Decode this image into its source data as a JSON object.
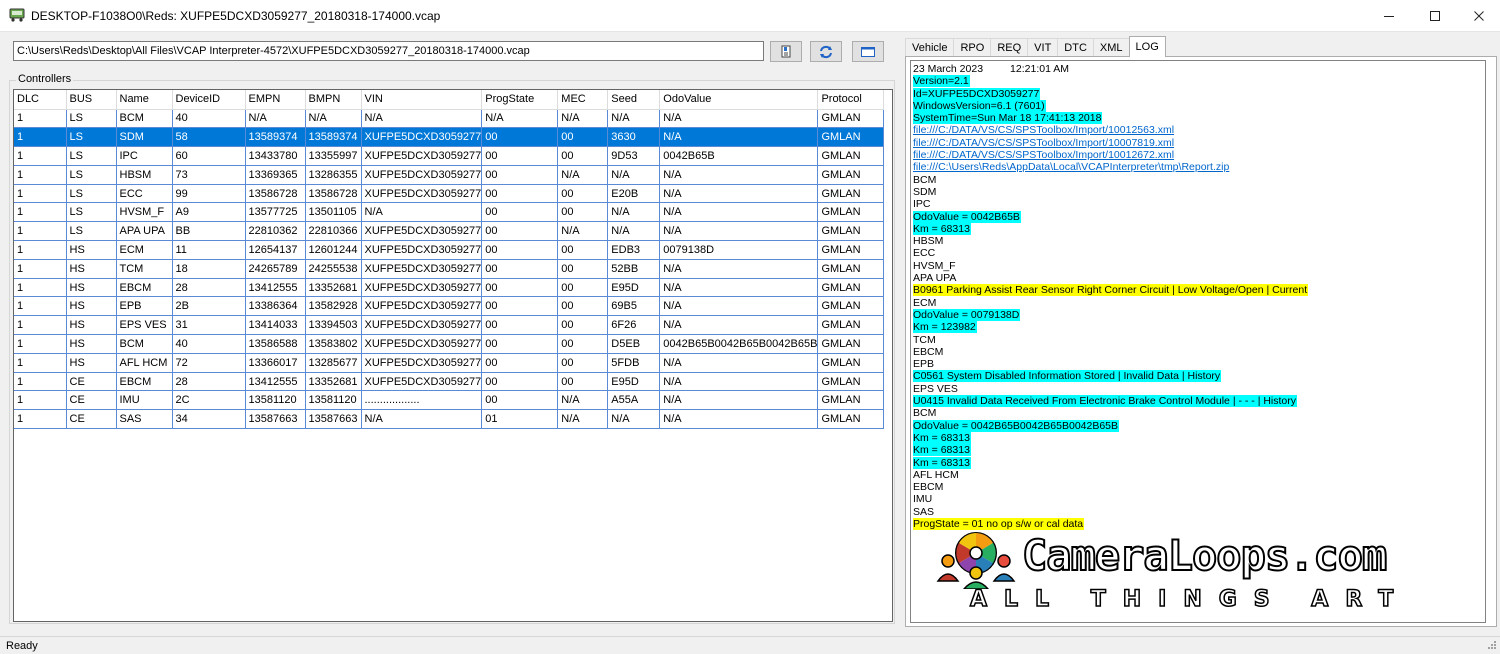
{
  "window": {
    "title": "DESKTOP-F1038O0\\Reds: XUFPE5DCXD3059277_20180318-174000.vcap"
  },
  "toolbar": {
    "path_value": "C:\\Users\\Reds\\Desktop\\All Files\\VCAP Interpreter-4572\\XUFPE5DCXD3059277_20180318-174000.vcap"
  },
  "controllers": {
    "group_label": "Controllers",
    "columns": [
      "DLC",
      "BUS",
      "Name",
      "DeviceID",
      "EMPN",
      "BMPN",
      "VIN",
      "ProgState",
      "MEC",
      "Seed",
      "OdoValue",
      "Protocol"
    ],
    "rows": [
      [
        "1",
        "LS",
        "BCM",
        "40",
        "N/A",
        "N/A",
        "N/A",
        "N/A",
        "N/A",
        "N/A",
        "N/A",
        "GMLAN"
      ],
      [
        "1",
        "LS",
        "SDM",
        "58",
        "13589374",
        "13589374",
        "XUFPE5DCXD3059277",
        "00",
        "00",
        "3630",
        "N/A",
        "GMLAN"
      ],
      [
        "1",
        "LS",
        "IPC",
        "60",
        "13433780",
        "13355997",
        "XUFPE5DCXD3059277",
        "00",
        "00",
        "9D53",
        "0042B65B",
        "GMLAN"
      ],
      [
        "1",
        "LS",
        "HBSM",
        "73",
        "13369365",
        "13286355",
        "XUFPE5DCXD3059277",
        "00",
        "N/A",
        "N/A",
        "N/A",
        "GMLAN"
      ],
      [
        "1",
        "LS",
        "ECC",
        "99",
        "13586728",
        "13586728",
        "XUFPE5DCXD3059277",
        "00",
        "00",
        "E20B",
        "N/A",
        "GMLAN"
      ],
      [
        "1",
        "LS",
        "HVSM_F",
        "A9",
        "13577725",
        "13501105",
        "N/A",
        "00",
        "00",
        "N/A",
        "N/A",
        "GMLAN"
      ],
      [
        "1",
        "LS",
        "APA UPA",
        "BB",
        "22810362",
        "22810366",
        "XUFPE5DCXD3059277",
        "00",
        "N/A",
        "N/A",
        "N/A",
        "GMLAN"
      ],
      [
        "1",
        "HS",
        "ECM",
        "11",
        "12654137",
        "12601244",
        "XUFPE5DCXD3059277",
        "00",
        "00",
        "EDB3",
        "0079138D",
        "GMLAN"
      ],
      [
        "1",
        "HS",
        "TCM",
        "18",
        "24265789",
        "24255538",
        "XUFPE5DCXD3059277",
        "00",
        "00",
        "52BB",
        "N/A",
        "GMLAN"
      ],
      [
        "1",
        "HS",
        "EBCM",
        "28",
        "13412555",
        "13352681",
        "XUFPE5DCXD3059277",
        "00",
        "00",
        "E95D",
        "N/A",
        "GMLAN"
      ],
      [
        "1",
        "HS",
        "EPB",
        "2B",
        "13386364",
        "13582928",
        "XUFPE5DCXD3059277",
        "00",
        "00",
        "69B5",
        "N/A",
        "GMLAN"
      ],
      [
        "1",
        "HS",
        "EPS VES",
        "31",
        "13414033",
        "13394503",
        "XUFPE5DCXD3059277",
        "00",
        "00",
        "6F26",
        "N/A",
        "GMLAN"
      ],
      [
        "1",
        "HS",
        "BCM",
        "40",
        "13586588",
        "13583802",
        "XUFPE5DCXD3059277",
        "00",
        "00",
        "D5EB",
        "0042B65B0042B65B0042B65B",
        "GMLAN"
      ],
      [
        "1",
        "HS",
        "AFL HCM",
        "72",
        "13366017",
        "13285677",
        "XUFPE5DCXD3059277",
        "00",
        "00",
        "5FDB",
        "N/A",
        "GMLAN"
      ],
      [
        "1",
        "CE",
        "EBCM",
        "28",
        "13412555",
        "13352681",
        "XUFPE5DCXD3059277",
        "00",
        "00",
        "E95D",
        "N/A",
        "GMLAN"
      ],
      [
        "1",
        "CE",
        "IMU",
        "2C",
        "13581120",
        "13581120",
        "..................",
        "00",
        "N/A",
        "A55A",
        "N/A",
        "GMLAN"
      ],
      [
        "1",
        "CE",
        "SAS",
        "34",
        "13587663",
        "13587663",
        "N/A",
        "01",
        "N/A",
        "N/A",
        "N/A",
        "GMLAN"
      ]
    ],
    "selected_row": 1
  },
  "tabs": [
    {
      "label": "Vehicle",
      "active": false
    },
    {
      "label": "RPO",
      "active": false
    },
    {
      "label": "REQ",
      "active": false
    },
    {
      "label": "VIT",
      "active": false
    },
    {
      "label": "DTC",
      "active": false
    },
    {
      "label": "XML",
      "active": false
    },
    {
      "label": "LOG",
      "active": true
    }
  ],
  "log": {
    "date": "23 March 2023",
    "time": "12:21:01 AM",
    "lines": [
      {
        "text": "Version=2.1",
        "style": "cyan"
      },
      {
        "text": "Id=XUFPE5DCXD3059277",
        "style": "cyan"
      },
      {
        "text": "WindowsVersion=6.1 (7601)",
        "style": "cyan"
      },
      {
        "text": "SystemTime=Sun Mar 18 17:41:13 2018",
        "style": "cyan"
      },
      {
        "text": "file:///C:/DATA/VS/CS/SPSToolbox/Import/10012563.xml",
        "style": "link"
      },
      {
        "text": "file:///C:/DATA/VS/CS/SPSToolbox/Import/10007819.xml",
        "style": "link"
      },
      {
        "text": "file:///C:/DATA/VS/CS/SPSToolbox/Import/10012672.xml",
        "style": "link"
      },
      {
        "text": "file:///C:\\Users\\Reds\\AppData\\Local\\VCAPInterpreter\\tmp\\Report.zip",
        "style": "link"
      },
      {
        "text": "BCM",
        "style": "plain"
      },
      {
        "text": "SDM",
        "style": "plain"
      },
      {
        "text": "IPC",
        "style": "plain"
      },
      {
        "text": "OdoValue = 0042B65B",
        "style": "cyan"
      },
      {
        "text": "Km = 68313",
        "style": "cyan"
      },
      {
        "text": "HBSM",
        "style": "plain"
      },
      {
        "text": "ECC",
        "style": "plain"
      },
      {
        "text": "HVSM_F",
        "style": "plain"
      },
      {
        "text": "APA UPA",
        "style": "plain"
      },
      {
        "text": "B0961  Parking Assist Rear Sensor Right Corner Circuit | Low Voltage/Open | Current",
        "style": "yellow"
      },
      {
        "text": "ECM",
        "style": "plain"
      },
      {
        "text": "OdoValue = 0079138D",
        "style": "cyan"
      },
      {
        "text": "Km = 123982",
        "style": "cyan"
      },
      {
        "text": "TCM",
        "style": "plain"
      },
      {
        "text": "EBCM",
        "style": "plain"
      },
      {
        "text": "EPB",
        "style": "plain"
      },
      {
        "text": "C0561  System Disabled Information Stored | Invalid Data | History",
        "style": "cyan"
      },
      {
        "text": "EPS VES",
        "style": "plain"
      },
      {
        "text": "U0415  Invalid Data Received From Electronic Brake Control Module | - - - | History",
        "style": "cyan"
      },
      {
        "text": "BCM",
        "style": "plain"
      },
      {
        "text": "OdoValue = 0042B65B0042B65B0042B65B",
        "style": "cyan"
      },
      {
        "text": "Km = 68313",
        "style": "cyan"
      },
      {
        "text": "Km = 68313",
        "style": "cyan"
      },
      {
        "text": "Km = 68313",
        "style": "cyan"
      },
      {
        "text": "AFL HCM",
        "style": "plain"
      },
      {
        "text": "EBCM",
        "style": "plain"
      },
      {
        "text": "IMU",
        "style": "plain"
      },
      {
        "text": "SAS",
        "style": "plain"
      },
      {
        "text": "ProgState = 01 no op s/w or cal data",
        "style": "yellow"
      }
    ]
  },
  "watermark": {
    "title": "CameraLoops.com",
    "subtitle": "ALL THINGS ART"
  },
  "status": {
    "text": "Ready"
  },
  "icons": {
    "minimize": "minimize-icon",
    "maximize": "maximize-icon",
    "close": "close-icon",
    "open_file": "open-file-icon",
    "refresh": "refresh-icon",
    "panel": "panel-icon"
  },
  "colors": {
    "selection": "#0078d7",
    "log_cyan": "#00ffff",
    "log_yellow": "#ffff00",
    "grid_lines": "#5a8ad6"
  }
}
